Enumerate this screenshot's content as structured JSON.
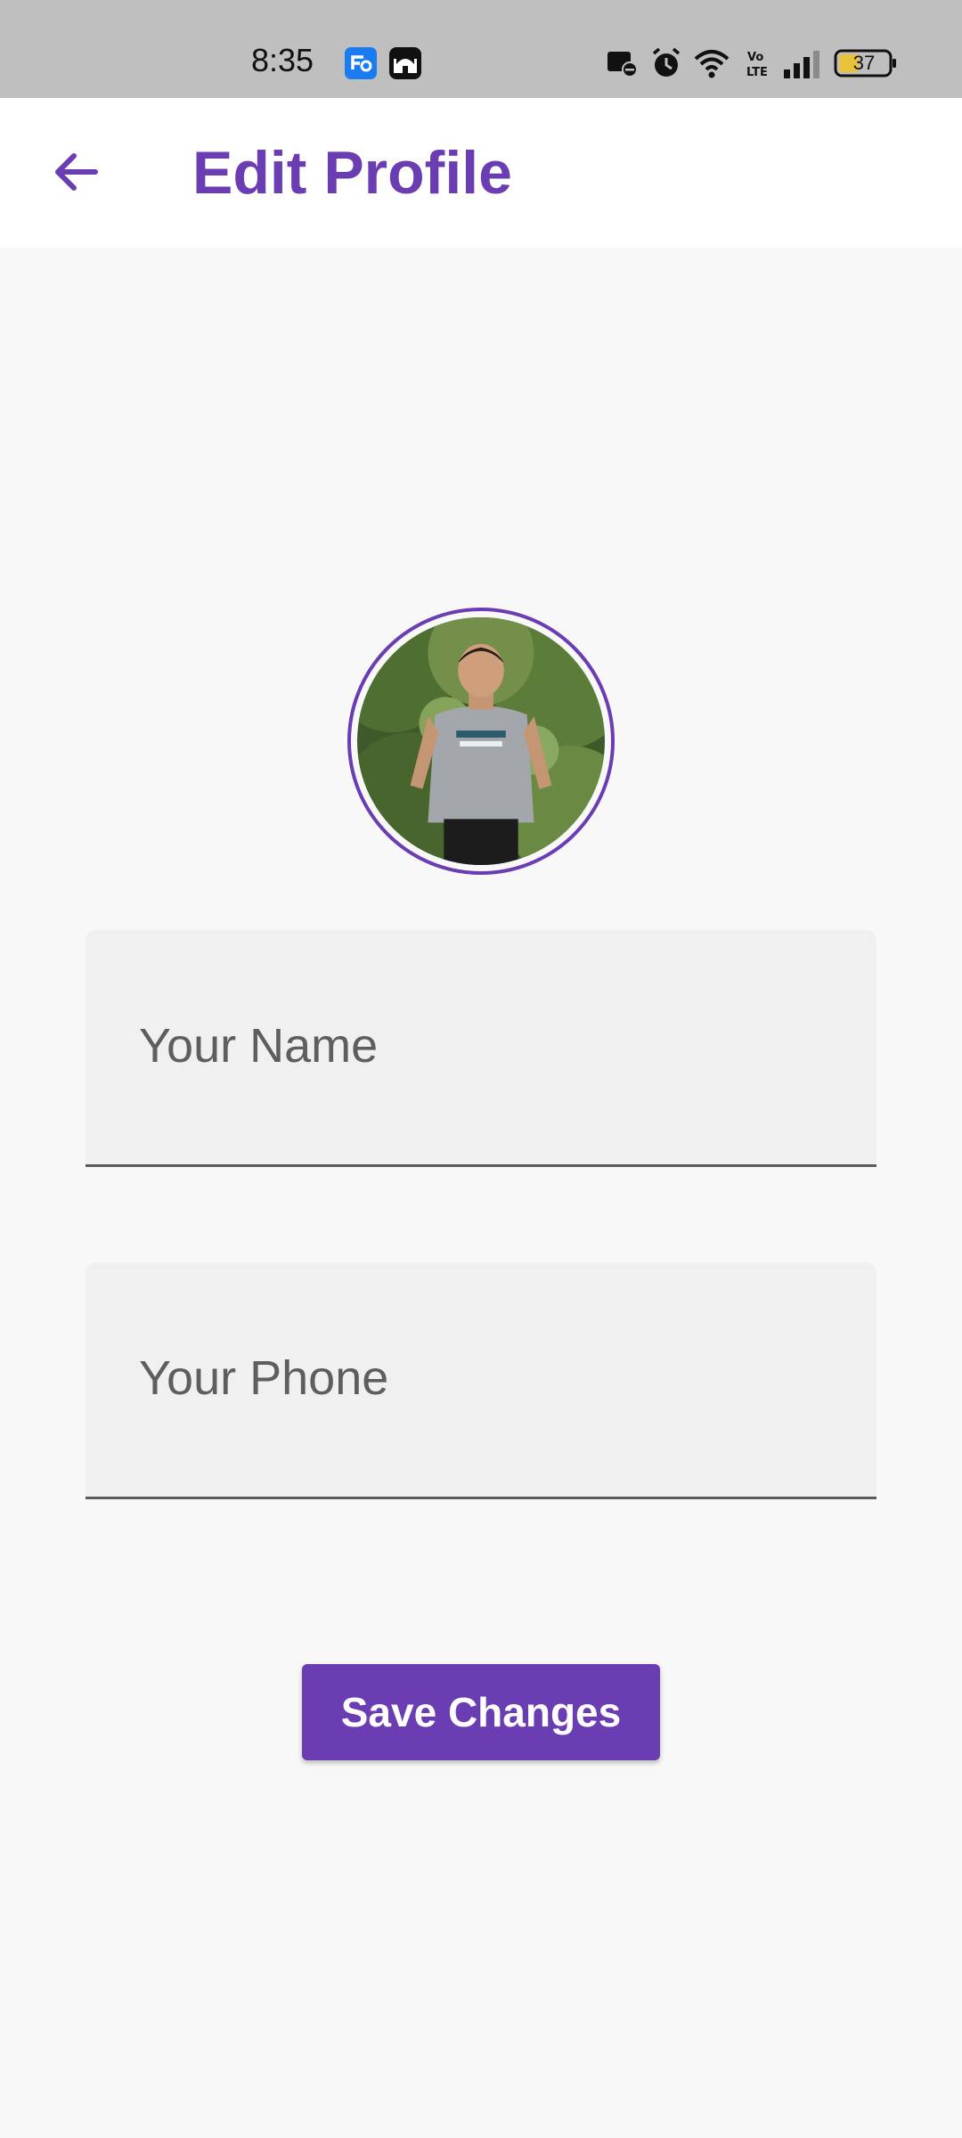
{
  "status_bar": {
    "time": "8:35",
    "battery_level": "37",
    "icons": [
      "app-notification-icon",
      "mosque-app-icon",
      "cast-dnd-icon",
      "alarm-icon",
      "wifi-icon",
      "volte-icon",
      "signal-icon",
      "battery-icon"
    ]
  },
  "header": {
    "title": "Edit Profile",
    "back_icon": "arrow-left-icon"
  },
  "profile": {
    "avatar": "profile-photo"
  },
  "form": {
    "name_placeholder": "Your Name",
    "name_value": "",
    "phone_placeholder": "Your Phone",
    "phone_value": "",
    "save_label": "Save Changes"
  },
  "colors": {
    "accent": "#6a3db3",
    "background": "#f8f8f8",
    "field_fill": "#f0f0f0",
    "status_bar": "#bfbfbf"
  }
}
